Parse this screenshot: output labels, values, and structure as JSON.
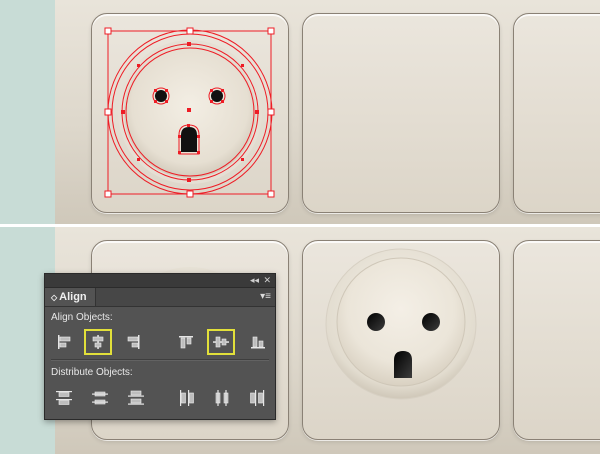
{
  "colors": {
    "background_teal": "#c8dcd6",
    "panel_beige": "#e4ded3",
    "selection_red": "#ee1c25",
    "highlight_yellow": "#e2e03a",
    "panel_gray": "#535353"
  },
  "align_panel": {
    "collapse_icon": "collapse-arrows-icon",
    "close_icon": "close-icon",
    "collapse_glyph": "◂◂",
    "close_glyph": "✕",
    "tab_arrow": "◇",
    "tab_label": "Align",
    "menu_glyph": "▾≡",
    "align_objects_label": "Align Objects:",
    "distribute_objects_label": "Distribute Objects:",
    "align_buttons": [
      {
        "icon": "horizontal-align-left-icon",
        "selected": false
      },
      {
        "icon": "horizontal-align-center-icon",
        "selected": true
      },
      {
        "icon": "horizontal-align-right-icon",
        "selected": false
      },
      {
        "icon": "vertical-align-top-icon",
        "selected": false
      },
      {
        "icon": "vertical-align-center-icon",
        "selected": true
      },
      {
        "icon": "vertical-align-bottom-icon",
        "selected": false
      }
    ],
    "distribute_buttons": [
      {
        "icon": "vertical-distribute-top-icon"
      },
      {
        "icon": "vertical-distribute-center-icon"
      },
      {
        "icon": "vertical-distribute-bottom-icon"
      },
      {
        "icon": "horizontal-distribute-left-icon"
      },
      {
        "icon": "horizontal-distribute-center-icon"
      },
      {
        "icon": "horizontal-distribute-right-icon"
      }
    ]
  }
}
